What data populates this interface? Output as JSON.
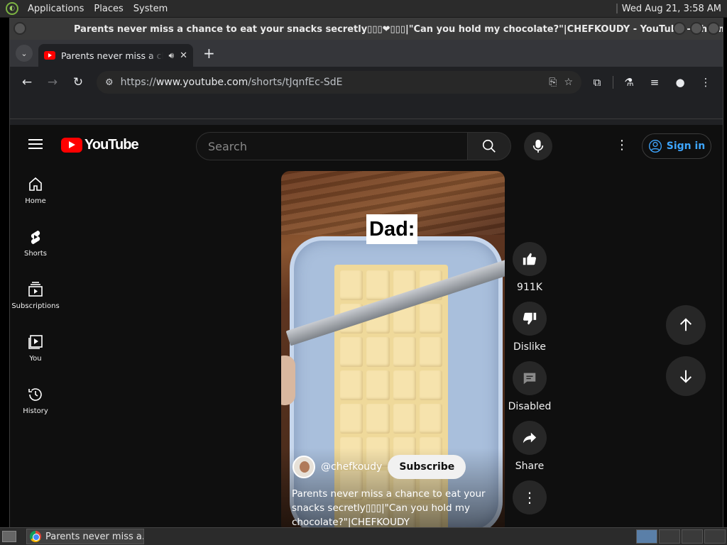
{
  "os_panel": {
    "menus": [
      "Applications",
      "Places",
      "System"
    ],
    "clock": "Wed Aug 21,  3:58 AM"
  },
  "window": {
    "title": "Parents never miss a chance to eat your snacks secretly▯▯▯❤▯▯▯|\"Can you hold my chocolate?\"|CHEFKOUDY - YouTube - Chromium"
  },
  "browser": {
    "tab": {
      "title": "Parents never miss a chance"
    },
    "address": {
      "prefix": "https://",
      "host": "www.youtube.com",
      "path": "/shorts/tJqnfEc-SdE"
    }
  },
  "youtube": {
    "logo_text": "YouTube",
    "search_placeholder": "Search",
    "signin_label": "Sign in",
    "sidebar": [
      {
        "label": "Home",
        "icon": "home-icon"
      },
      {
        "label": "Shorts",
        "icon": "shorts-icon"
      },
      {
        "label": "Subscriptions",
        "icon": "subscriptions-icon"
      },
      {
        "label": "You",
        "icon": "you-icon"
      },
      {
        "label": "History",
        "icon": "history-icon"
      }
    ],
    "short": {
      "overlay_text": "Dad:",
      "channel_handle": "@chefkoudy",
      "subscribe_label": "Subscribe",
      "caption": "Parents never miss a chance to eat your snacks secretly▯▯▯|\"Can you hold my chocolate?\"|CHEFKOUDY"
    },
    "actions": {
      "likes": "911K",
      "dislike": "Dislike",
      "comments": "Disabled",
      "share": "Share"
    }
  },
  "taskbar": {
    "task_label": "Parents never miss a..."
  },
  "colors": {
    "yt_red": "#ff0000",
    "signin_blue": "#3ea6ff",
    "page_bg": "#0f0f0f"
  }
}
